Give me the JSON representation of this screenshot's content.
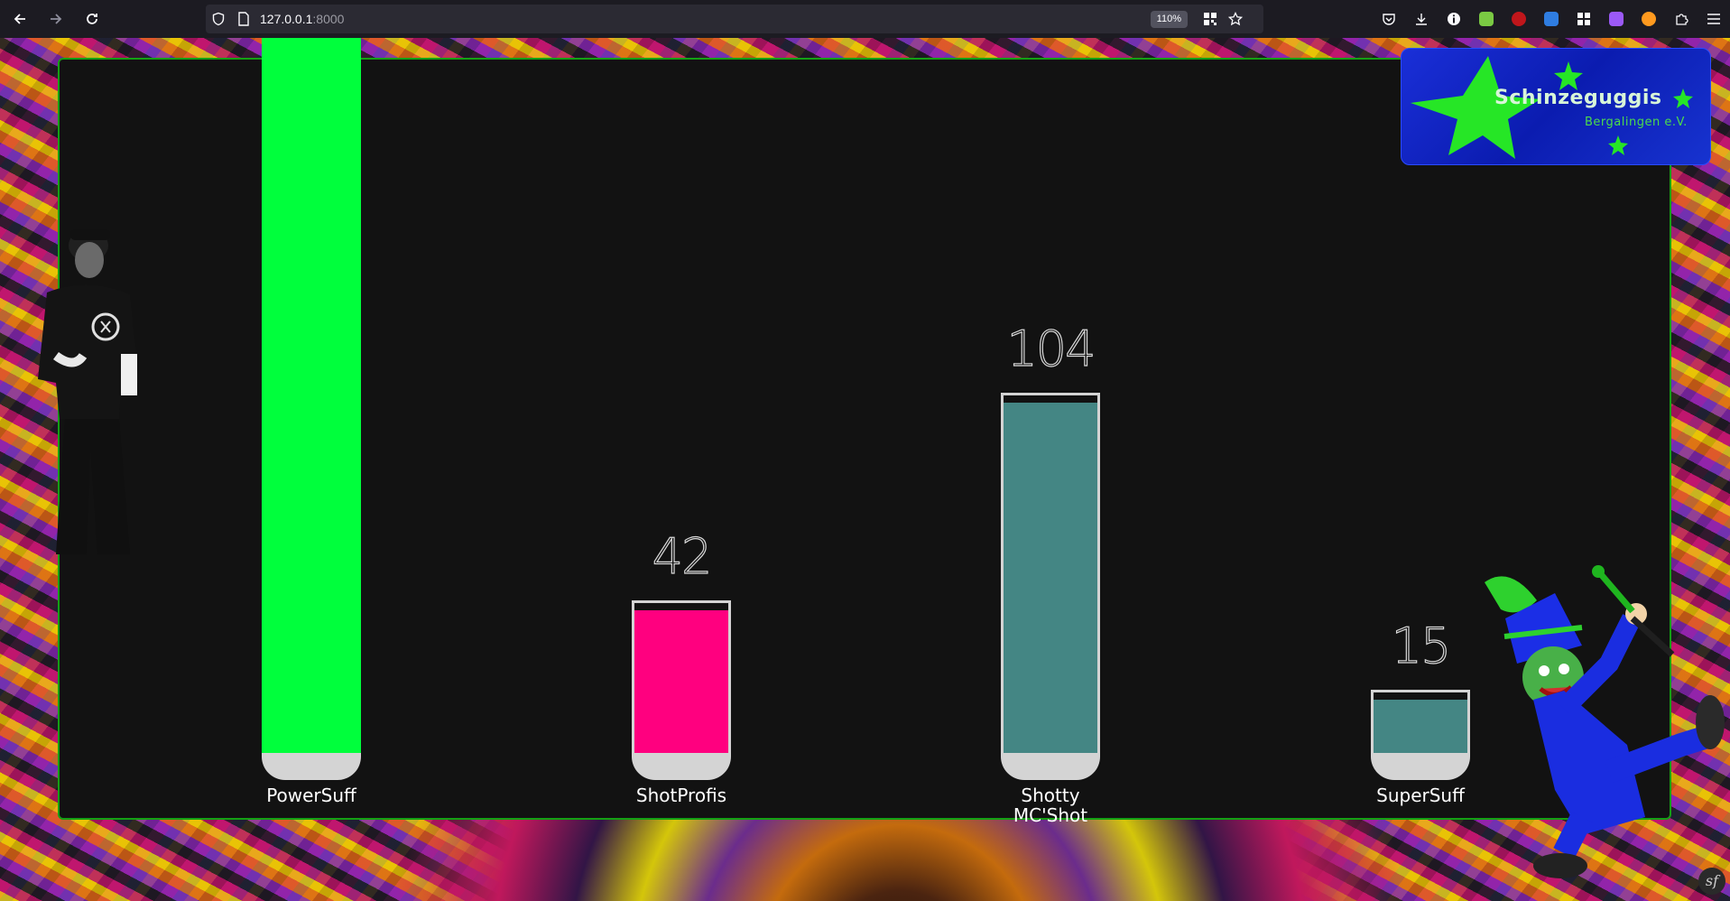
{
  "browser": {
    "url_host": "127.0.0.1",
    "url_port": ":8000",
    "zoom": "110%",
    "icons": [
      "back-arrow-icon",
      "forward-arrow-icon",
      "reload-icon",
      "shield-icon",
      "page-icon",
      "qr-code-icon",
      "bookmark-star-icon",
      "pocket-icon",
      "download-icon",
      "info-icon",
      "extension-icons",
      "extensions-puzzle-icon",
      "hamburger-menu-icon"
    ]
  },
  "logo": {
    "title": "Schinzeguggis",
    "subtitle": "Bergalingen e.V."
  },
  "chart_data": {
    "type": "bar",
    "categories": [
      "PowerSuff",
      "ShotProfis",
      "Shotty MC'Shot",
      "SuperSuff"
    ],
    "values": [
      null,
      42,
      104,
      15
    ],
    "value_labels": [
      "",
      "42",
      "104",
      "15"
    ],
    "colors": [
      "#00ff3c",
      "#ff007f",
      "#448684",
      "#448684"
    ],
    "overflow": [
      true,
      false,
      false,
      false
    ],
    "ylim": [
      0,
      200
    ],
    "grid": false
  },
  "corner_badge": "sf"
}
